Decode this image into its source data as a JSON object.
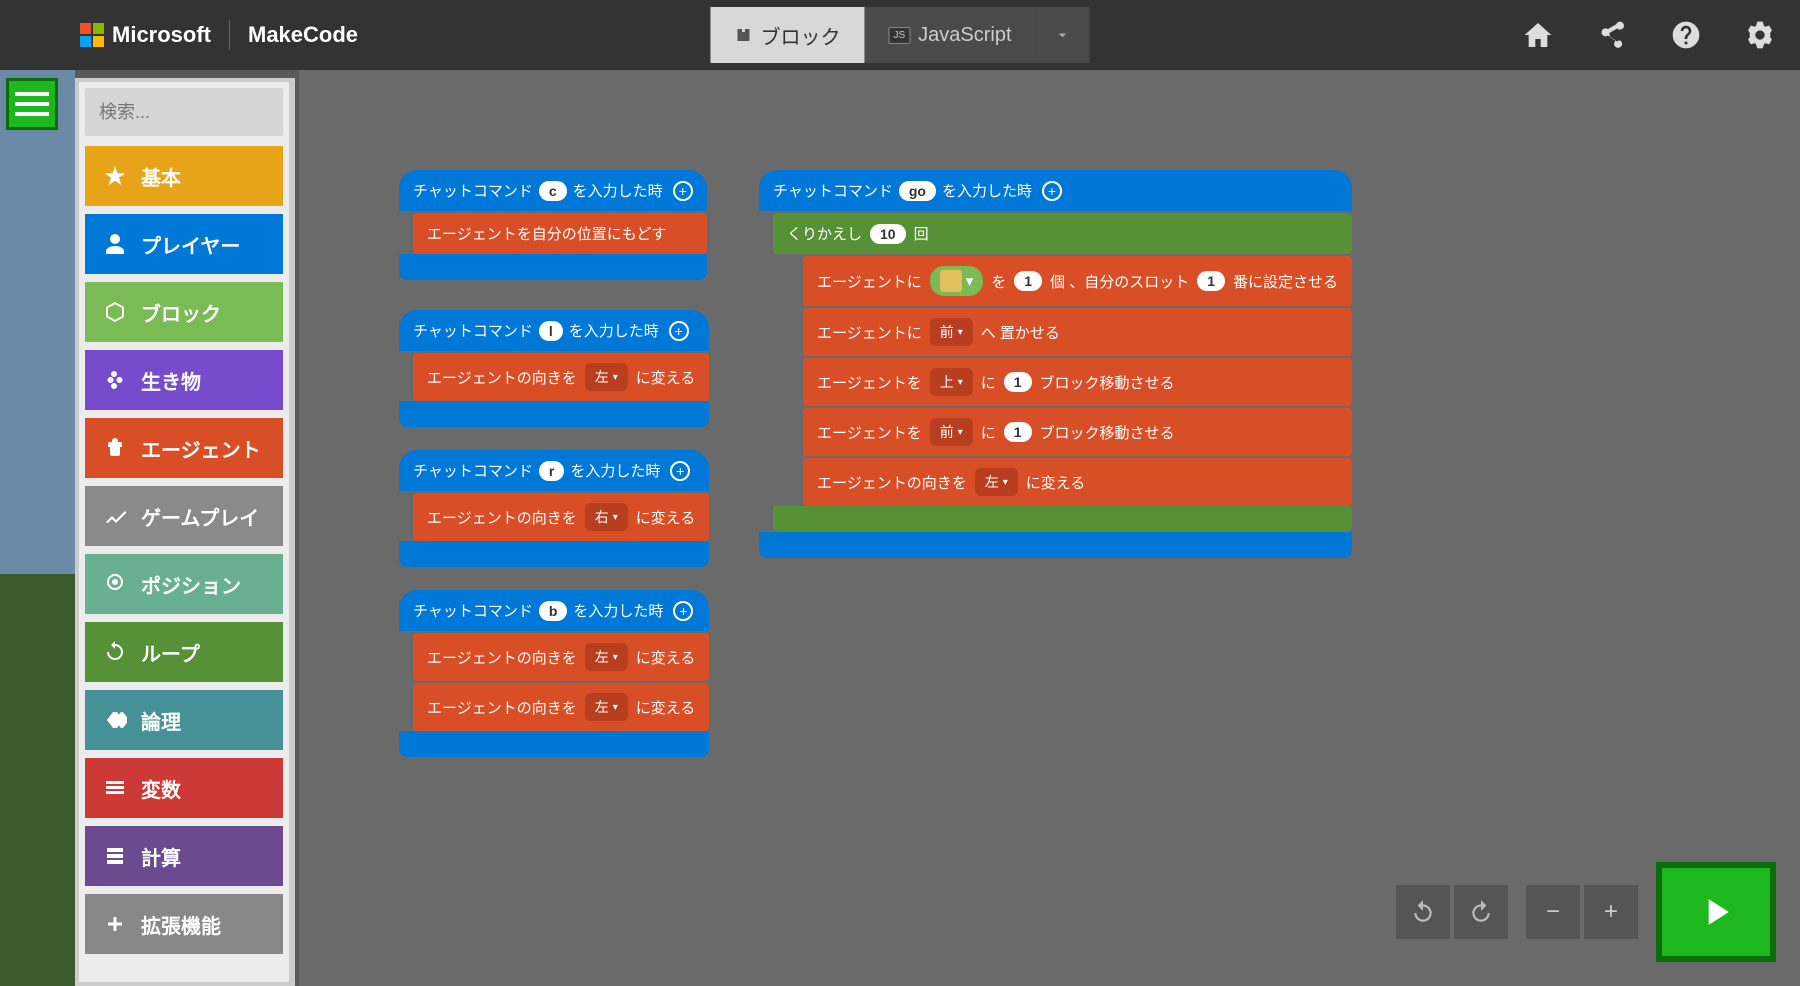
{
  "header": {
    "ms_label": "Microsoft",
    "app_name": "MakeCode",
    "tabs": {
      "blocks": "ブロック",
      "javascript": "JavaScript"
    }
  },
  "search": {
    "placeholder": "検索..."
  },
  "categories": {
    "basic": "基本",
    "player": "プレイヤー",
    "block": "ブロック",
    "creature": "生き物",
    "agent": "エージェント",
    "gameplay": "ゲームプレイ",
    "position": "ポジション",
    "loop": "ループ",
    "logic": "論理",
    "variable": "変数",
    "math": "計算",
    "ext": "拡張機能"
  },
  "blocks": {
    "chat_prefix": "チャットコマンド",
    "chat_suffix": "を入力した時",
    "c": {
      "cmd": "c",
      "teleport": "エージェントを自分の位置にもどす"
    },
    "l": {
      "cmd": "l",
      "turn_label": "エージェントの向きを",
      "dir": "左",
      "turn_suffix": "に変える"
    },
    "r": {
      "cmd": "r",
      "turn_label": "エージェントの向きを",
      "dir": "右",
      "turn_suffix": "に変える"
    },
    "b": {
      "cmd": "b",
      "turn_label": "エージェントの向きを",
      "dir": "左",
      "turn_suffix": "に変える"
    },
    "go": {
      "cmd": "go",
      "repeat_prefix": "くりかえし",
      "repeat_count": "10",
      "repeat_suffix": "回",
      "setitem_1": "エージェントに",
      "setitem_2": "を",
      "setitem_count": "1",
      "setitem_3": "個 、自分のスロット",
      "setitem_slot": "1",
      "setitem_4": "番に設定させる",
      "place_1": "エージェントに",
      "place_dir": "前",
      "place_2": "へ 置かせる",
      "move_1": "エージェントを",
      "move_up": "上",
      "move_2": "に",
      "move_n": "1",
      "move_3": "ブロック移動させる",
      "move_fwd": "前",
      "turn_label": "エージェントの向きを",
      "turn_dir": "左",
      "turn_suffix": "に変える"
    }
  }
}
